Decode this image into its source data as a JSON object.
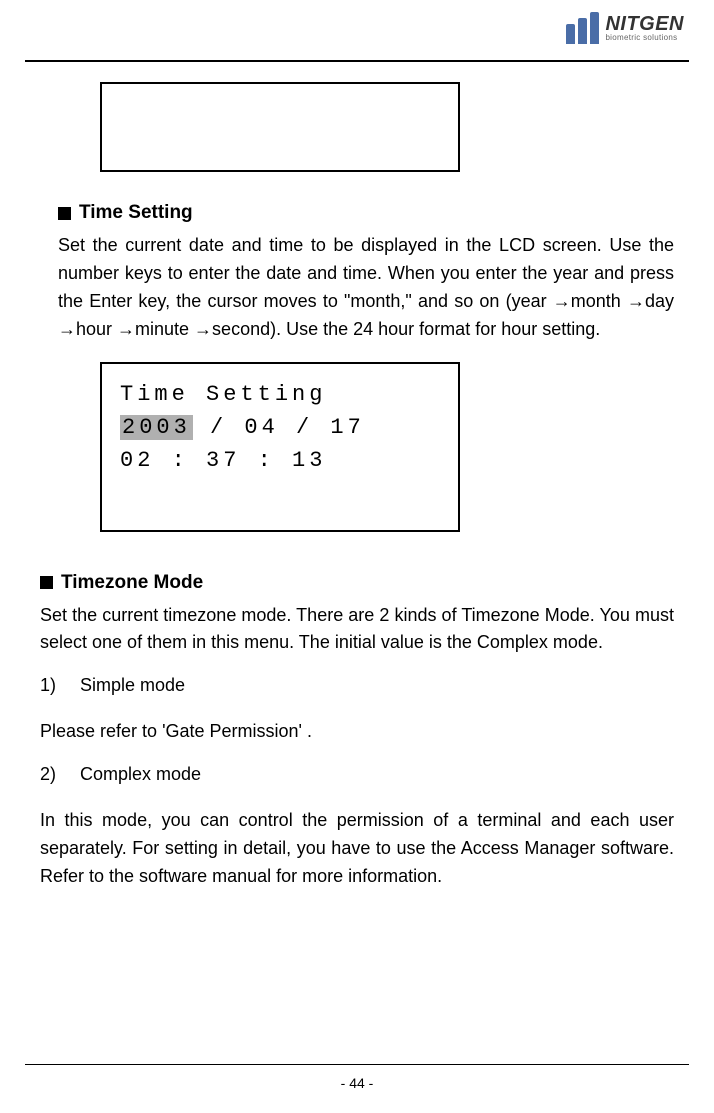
{
  "logo": {
    "name": "NITGEN",
    "tagline": "biometric solutions"
  },
  "section1": {
    "heading": "Time Setting",
    "paragraph": "Set the current date and time to be displayed in the LCD screen. Use the number keys to enter the date and time. When you enter the year and press the Enter key, the cursor moves to  \"month,\" and so on (year →month →day →hour →minute →second). Use the 24 hour format for hour setting."
  },
  "lcd": {
    "line1": "Time Setting",
    "year": "2003",
    "date_rest": " / 04 / 17",
    "line3": "02 : 37 : 13"
  },
  "section2": {
    "heading": "Timezone Mode",
    "paragraph": "Set the current timezone mode. There are 2 kinds of Timezone Mode. You must select one of them in this menu. The initial value is the Complex mode.",
    "item1_num": "1)",
    "item1_text": "Simple mode",
    "ref1": "Please refer to 'Gate Permission' .",
    "item2_num": "2)",
    "item2_text": "Complex mode",
    "paragraph2": "In this mode, you can control the permission of a terminal and each user separately. For setting in detail, you have to use the Access Manager software. Refer to the software manual for more information."
  },
  "page_number": "- 44 -"
}
